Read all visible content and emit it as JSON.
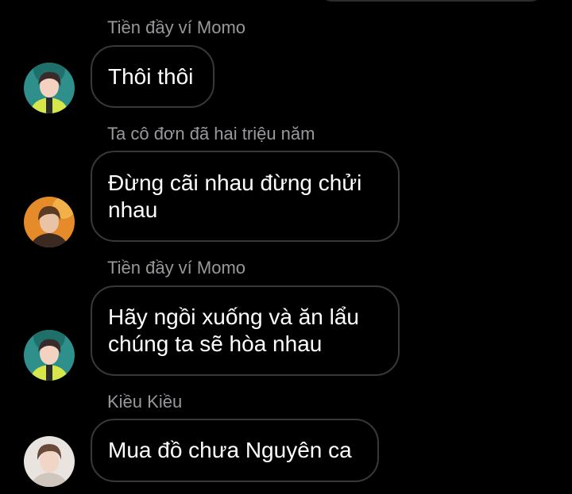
{
  "messages": [
    {
      "sender": "Tiền đầy ví Momo",
      "text": "Thôi thôi",
      "avatar_icon": "boy-teal-background-yellow-shirt-avatar-icon"
    },
    {
      "sender": "Ta cô đơn đã hai triệu năm",
      "text": "Đừng cãi nhau đừng chửi nhau",
      "avatar_icon": "boy-orange-background-avatar-icon"
    },
    {
      "sender": "Tiền đầy ví Momo",
      "text": "Hãy ngồi xuống và ăn lẩu chúng ta sẽ hòa nhau",
      "avatar_icon": "boy-teal-background-yellow-shirt-avatar-icon"
    },
    {
      "sender": "Kiều Kiều",
      "text": "Mua đồ chưa Nguyên ca",
      "avatar_icon": "boy-light-background-avatar-icon"
    }
  ],
  "colors": {
    "background": "#000000",
    "bubble_border": "#38383a",
    "message_text": "#ffffff",
    "sender_text": "#98989d"
  }
}
